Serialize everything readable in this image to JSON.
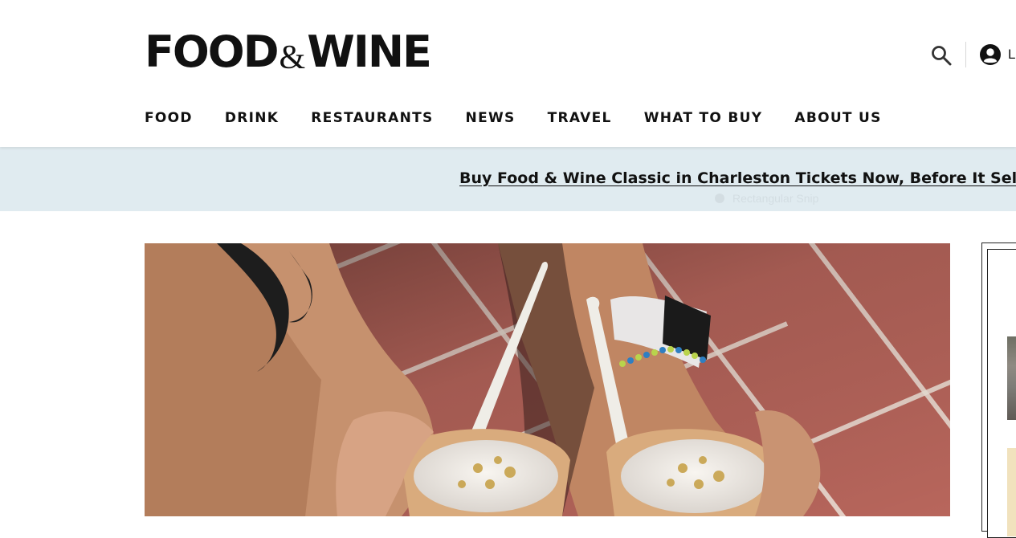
{
  "header": {
    "logo": {
      "left_word": "FOOD",
      "amp": "&",
      "right_word": "WINE"
    },
    "search_icon": "search-icon",
    "account": {
      "icon": "account-circle-icon",
      "label": "L"
    }
  },
  "nav": {
    "items": [
      {
        "label": "FOOD"
      },
      {
        "label": "DRINK"
      },
      {
        "label": "RESTAURANTS"
      },
      {
        "label": "NEWS"
      },
      {
        "label": "TRAVEL"
      },
      {
        "label": "WHAT TO BUY"
      },
      {
        "label": "ABOUT US"
      }
    ]
  },
  "promo": {
    "text": "Buy Food & Wine Classic in Charleston Tickets Now, Before It Sells Out",
    "overlay_text": "Rectangular Snip",
    "bg_color": "#e0ebf0"
  },
  "colors": {
    "text": "#111111",
    "tile": "#b8665c",
    "grout": "#f0e6dc"
  }
}
